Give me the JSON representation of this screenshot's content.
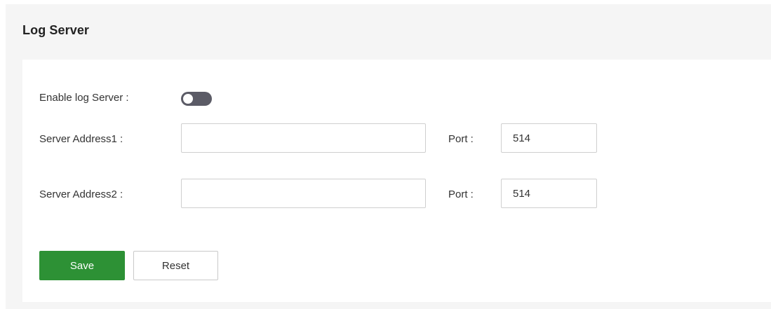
{
  "panel": {
    "title": "Log Server"
  },
  "form": {
    "enable_label": "Enable log Server :",
    "enable_state": "off",
    "server_address1": {
      "label": "Server Address1 :",
      "value": "",
      "port_label": "Port :",
      "port_value": "514"
    },
    "server_address2": {
      "label": "Server Address2 :",
      "value": "",
      "port_label": "Port :",
      "port_value": "514"
    }
  },
  "actions": {
    "save_label": "Save",
    "reset_label": "Reset"
  },
  "colors": {
    "primary": "#2d9135",
    "toggle_off": "#5b5b66",
    "panel_background": "#f5f5f5"
  }
}
